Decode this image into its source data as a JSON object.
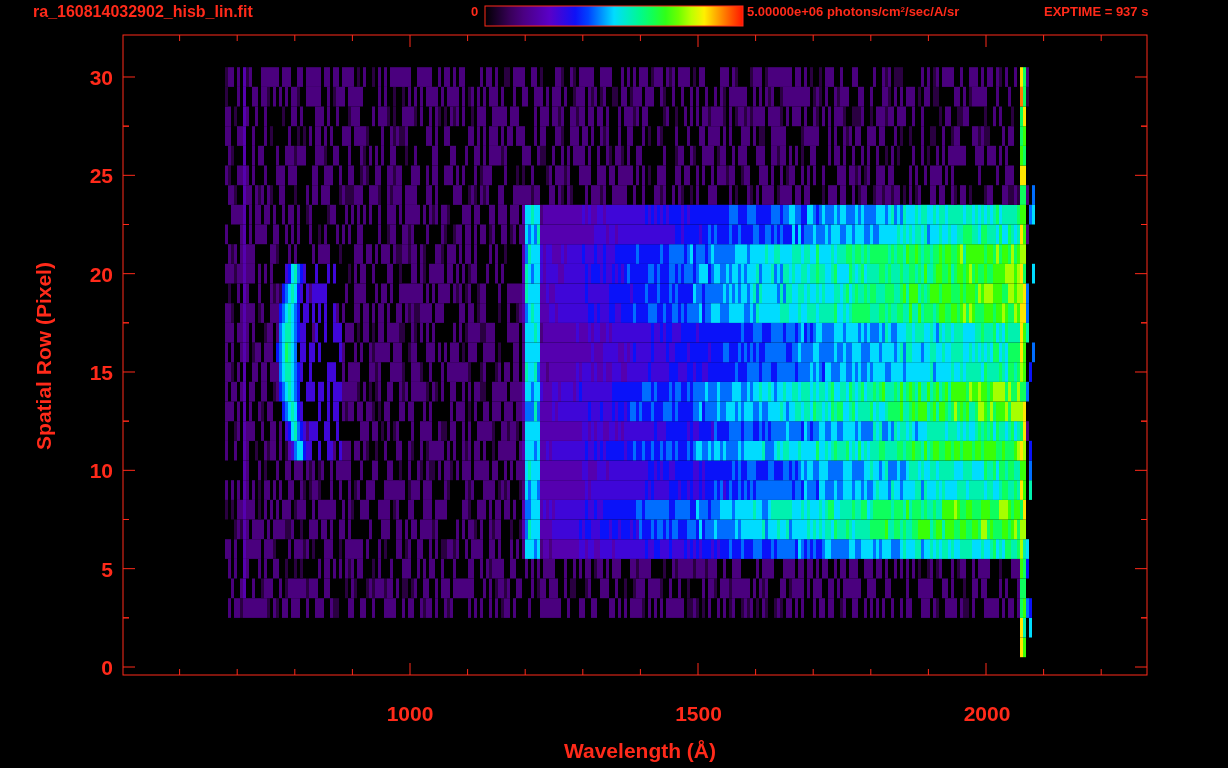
{
  "header": {
    "file_name": "ra_160814032902_hisb_lin.fit",
    "colorbar_min": "0",
    "colorbar_max": "5.00000e+06 photons/cm$^{2}$/sec/A/sr",
    "exposure": "EXPTIME = 937 s"
  },
  "plot": {
    "ylabel": "Spatial Row (Pixel)",
    "xlabel": "Wavelength (Å)",
    "xtick_labels": [
      "1000",
      "1500",
      "2000"
    ],
    "ytick_labels": [
      "30",
      "25",
      "20",
      "15",
      "10",
      "5",
      "0"
    ]
  }
}
